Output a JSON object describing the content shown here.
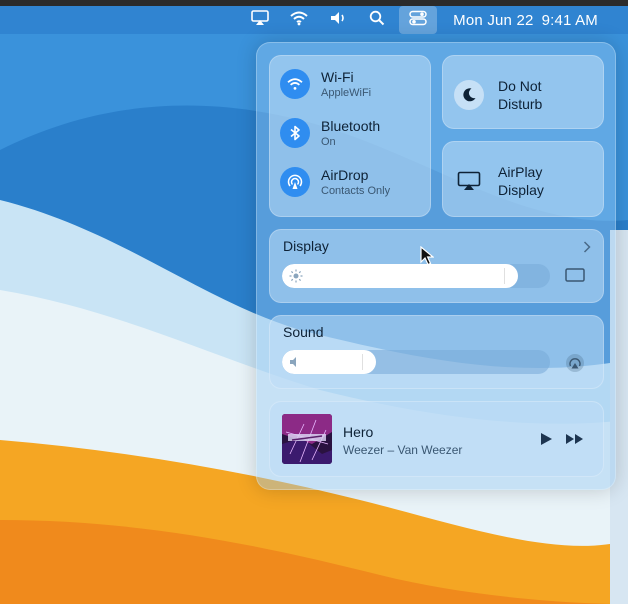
{
  "menubar": {
    "date": "Mon Jun 22",
    "time": "9:41 AM",
    "icons": [
      "airplay-icon",
      "wifi-icon",
      "volume-icon",
      "search-icon",
      "control-center-icon"
    ]
  },
  "control_center": {
    "network": {
      "wifi": {
        "title": "Wi-Fi",
        "subtitle": "AppleWiFi"
      },
      "bluetooth": {
        "title": "Bluetooth",
        "subtitle": "On"
      },
      "airdrop": {
        "title": "AirDrop",
        "subtitle": "Contacts Only"
      }
    },
    "dnd": {
      "line1": "Do Not",
      "line2": "Disturb"
    },
    "airplay": {
      "line1": "AirPlay",
      "line2": "Display"
    },
    "display": {
      "title": "Display",
      "level": 0.88
    },
    "sound": {
      "title": "Sound",
      "level": 0.35
    },
    "now_playing": {
      "title": "Hero",
      "artist": "Weezer – Van Weezer"
    }
  },
  "colors": {
    "accent": "#2f8df0",
    "wallpaper_blue": "#1f6fb8",
    "wallpaper_orange": "#f5a623"
  }
}
